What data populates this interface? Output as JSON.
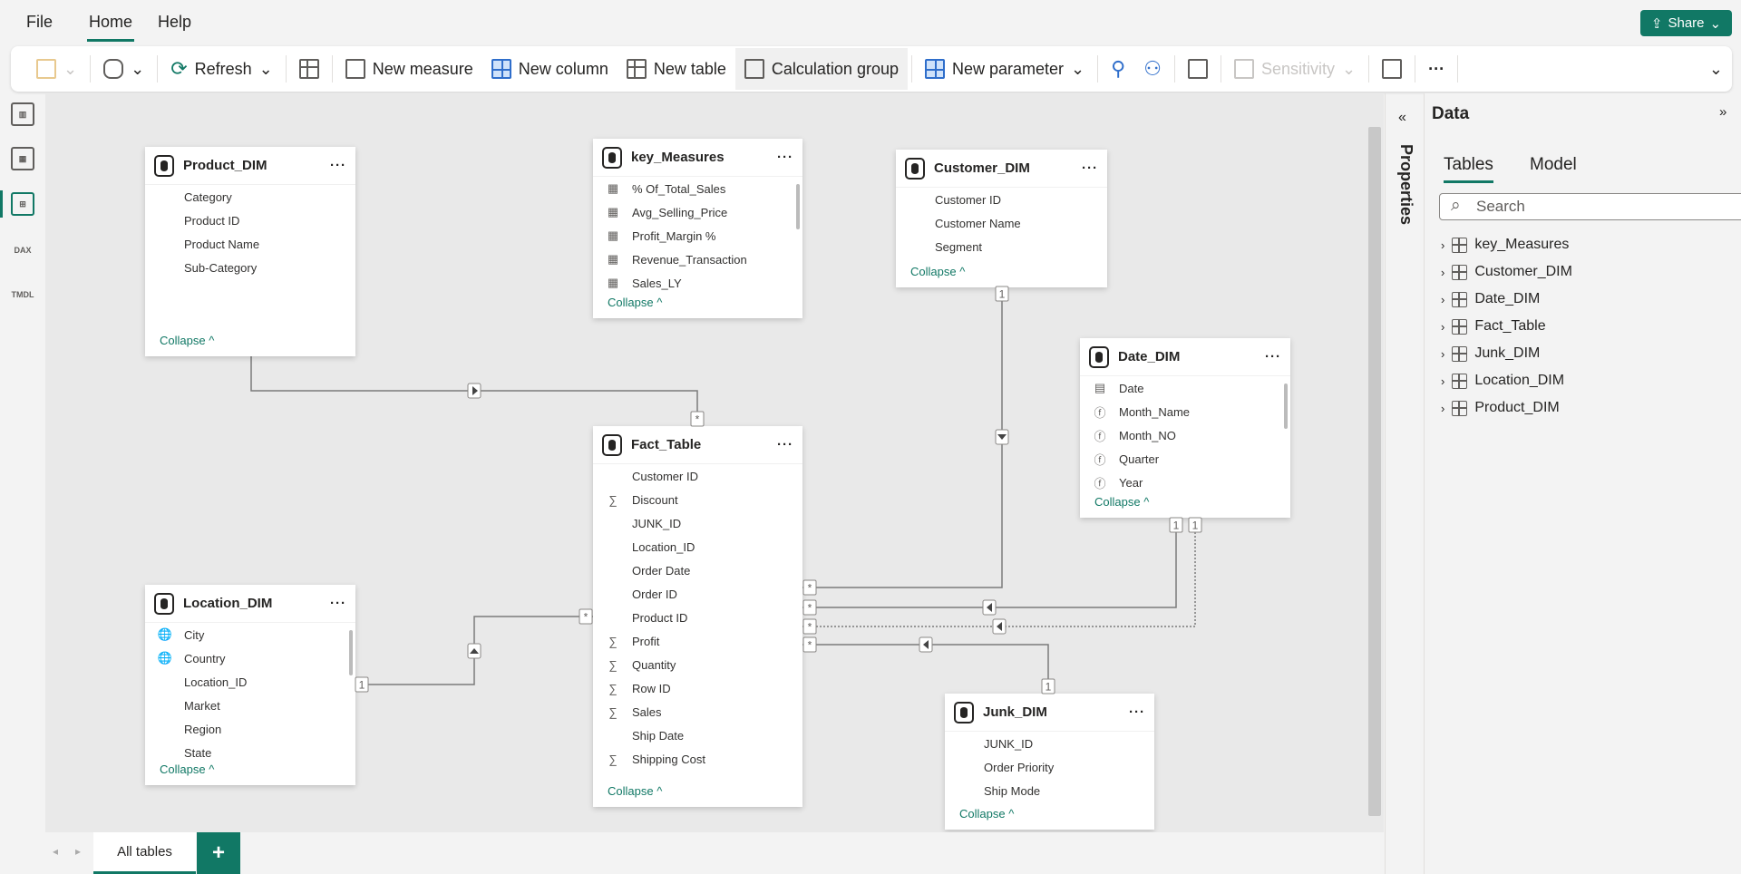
{
  "menu": {
    "file": "File",
    "home": "Home",
    "help": "Help",
    "share": "Share"
  },
  "ribbon": {
    "refresh": "Refresh",
    "new_measure": "New measure",
    "new_column": "New column",
    "new_table": "New table",
    "calculation_group": "Calculation group",
    "new_parameter": "New parameter",
    "sensitivity": "Sensitivity",
    "more": "···"
  },
  "rail": {
    "dax": "DAX",
    "tmdl": "TMDL"
  },
  "tables": [
    {
      "id": "product",
      "name": "Product_DIM",
      "fields": [
        {
          "n": "Category",
          "i": ""
        },
        {
          "n": "Product ID",
          "i": ""
        },
        {
          "n": "Product Name",
          "i": ""
        },
        {
          "n": "Sub-Category",
          "i": ""
        }
      ],
      "collapse": "Collapse ^"
    },
    {
      "id": "keym",
      "name": "key_Measures",
      "fields": [
        {
          "n": "% Of_Total_Sales",
          "i": "▦"
        },
        {
          "n": "Avg_Selling_Price",
          "i": "▦"
        },
        {
          "n": "Profit_Margin %",
          "i": "▦"
        },
        {
          "n": "Revenue_Transaction",
          "i": "▦"
        },
        {
          "n": "Sales_LY",
          "i": "▦"
        }
      ],
      "collapse": "Collapse ^"
    },
    {
      "id": "customer",
      "name": "Customer_DIM",
      "fields": [
        {
          "n": "Customer ID",
          "i": ""
        },
        {
          "n": "Customer Name",
          "i": ""
        },
        {
          "n": "Segment",
          "i": ""
        }
      ],
      "collapse": "Collapse ^"
    },
    {
      "id": "date",
      "name": "Date_DIM",
      "fields": [
        {
          "n": "Date",
          "i": "▤"
        },
        {
          "n": "Month_Name",
          "i": "ⓕ"
        },
        {
          "n": "Month_NO",
          "i": "ⓕ"
        },
        {
          "n": "Quarter",
          "i": "ⓕ"
        },
        {
          "n": "Year",
          "i": "ⓕ"
        }
      ],
      "collapse": "Collapse ^"
    },
    {
      "id": "fact",
      "name": "Fact_Table",
      "fields": [
        {
          "n": "Customer ID",
          "i": ""
        },
        {
          "n": "Discount",
          "i": "∑"
        },
        {
          "n": "JUNK_ID",
          "i": ""
        },
        {
          "n": "Location_ID",
          "i": ""
        },
        {
          "n": "Order Date",
          "i": ""
        },
        {
          "n": "Order ID",
          "i": ""
        },
        {
          "n": "Product ID",
          "i": ""
        },
        {
          "n": "Profit",
          "i": "∑"
        },
        {
          "n": "Quantity",
          "i": "∑"
        },
        {
          "n": "Row ID",
          "i": "∑"
        },
        {
          "n": "Sales",
          "i": "∑"
        },
        {
          "n": "Ship Date",
          "i": ""
        },
        {
          "n": "Shipping Cost",
          "i": "∑"
        }
      ],
      "collapse": "Collapse ^"
    },
    {
      "id": "location",
      "name": "Location_DIM",
      "fields": [
        {
          "n": "City",
          "i": "🌐"
        },
        {
          "n": "Country",
          "i": "🌐"
        },
        {
          "n": "Location_ID",
          "i": ""
        },
        {
          "n": "Market",
          "i": ""
        },
        {
          "n": "Region",
          "i": ""
        },
        {
          "n": "State",
          "i": ""
        }
      ],
      "collapse": "Collapse ^"
    },
    {
      "id": "junk",
      "name": "Junk_DIM",
      "fields": [
        {
          "n": "JUNK_ID",
          "i": ""
        },
        {
          "n": "Order Priority",
          "i": ""
        },
        {
          "n": "Ship Mode",
          "i": ""
        }
      ],
      "collapse": "Collapse ^"
    }
  ],
  "markers": {
    "one": "1",
    "many": "*"
  },
  "properties": "Properties",
  "data_pane": {
    "title": "Data",
    "tab_tables": "Tables",
    "tab_model": "Model",
    "search_placeholder": "Search",
    "items": [
      {
        "name": "key_Measures",
        "type": "measure"
      },
      {
        "name": "Customer_DIM",
        "type": "table"
      },
      {
        "name": "Date_DIM",
        "type": "measure"
      },
      {
        "name": "Fact_Table",
        "type": "table"
      },
      {
        "name": "Junk_DIM",
        "type": "table"
      },
      {
        "name": "Location_DIM",
        "type": "table"
      },
      {
        "name": "Product_DIM",
        "type": "table"
      }
    ]
  },
  "bottom": {
    "all_tables": "All tables",
    "add": "+"
  },
  "colors": {
    "accent": "#117865"
  }
}
